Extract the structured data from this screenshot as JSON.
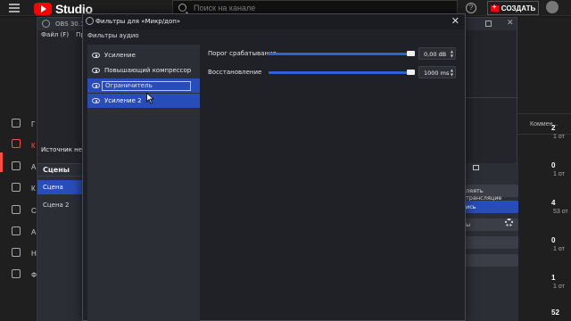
{
  "youtube": {
    "brand": "Studio",
    "search_placeholder": "Поиск на канале",
    "create_label": "СОЗДАТЬ",
    "sidebar_letters": [
      "Г",
      "К",
      "А",
      "К",
      "С",
      "А",
      "Н",
      "Ф"
    ],
    "comments_header": "Коммен...",
    "rows": [
      {
        "num": "2",
        "sub": "1 от"
      },
      {
        "num": "0",
        "sub": "1 от"
      },
      {
        "num": "4",
        "sub": "53 от"
      },
      {
        "num": "0",
        "sub": "1 от"
      },
      {
        "num": "1",
        "sub": "1 от"
      },
      {
        "num": "52",
        "sub": ""
      }
    ]
  },
  "obs": {
    "title": "OBS 30.1.2 -",
    "menu": [
      "Файл (F)",
      "Пра"
    ],
    "preview_label": "Источник не в",
    "scenes_header": "Сцены",
    "scenes": [
      "Сцена",
      "Сцена 2"
    ],
    "controls": [
      "ляять трансляцие",
      "ись",
      "ы",
      "",
      ""
    ]
  },
  "dialog": {
    "title": "Фильтры для «Микр/доп»",
    "section": "Фильтры аудио",
    "filters": [
      {
        "label": "Усиление",
        "state": "normal"
      },
      {
        "label": "Повышающий компрессор",
        "state": "normal"
      },
      {
        "label": "Ограничитель",
        "state": "editing"
      },
      {
        "label": "Усиление 2",
        "state": "selected"
      }
    ],
    "properties": [
      {
        "label": "Порог срабатывания",
        "value": "0,00 dB",
        "fill": 1.0
      },
      {
        "label": "Восстановление",
        "value": "1000 ms",
        "fill": 1.0
      }
    ]
  }
}
